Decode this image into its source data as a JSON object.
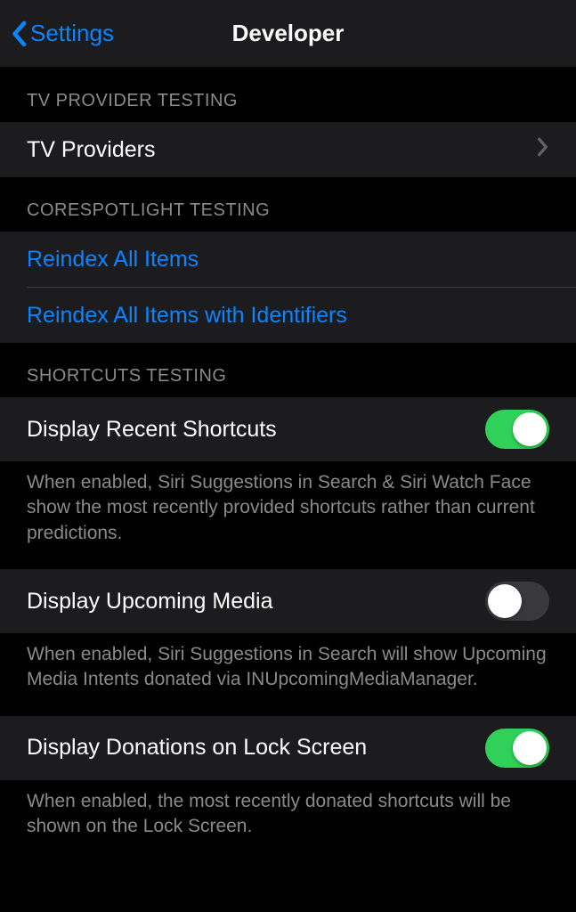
{
  "navbar": {
    "back_label": "Settings",
    "title": "Developer"
  },
  "sections": {
    "tv_provider": {
      "header": "TV PROVIDER TESTING",
      "row_label": "TV Providers"
    },
    "corespotlight": {
      "header": "CORESPOTLIGHT TESTING",
      "reindex_all": "Reindex All Items",
      "reindex_identifiers": "Reindex All Items with Identifiers"
    },
    "shortcuts": {
      "header": "SHORTCUTS TESTING",
      "display_recent": {
        "label": "Display Recent Shortcuts",
        "enabled": true,
        "footer": "When enabled, Siri Suggestions in Search & Siri Watch Face show the most recently provided shortcuts rather than current predictions."
      },
      "upcoming_media": {
        "label": "Display Upcoming Media",
        "enabled": false,
        "footer": "When enabled, Siri Suggestions in Search will show Upcoming Media Intents donated via INUpcomingMediaManager."
      },
      "donations_lock": {
        "label": "Display Donations on Lock Screen",
        "enabled": true,
        "footer": "When enabled, the most recently donated shortcuts will be shown on the Lock Screen."
      }
    }
  }
}
